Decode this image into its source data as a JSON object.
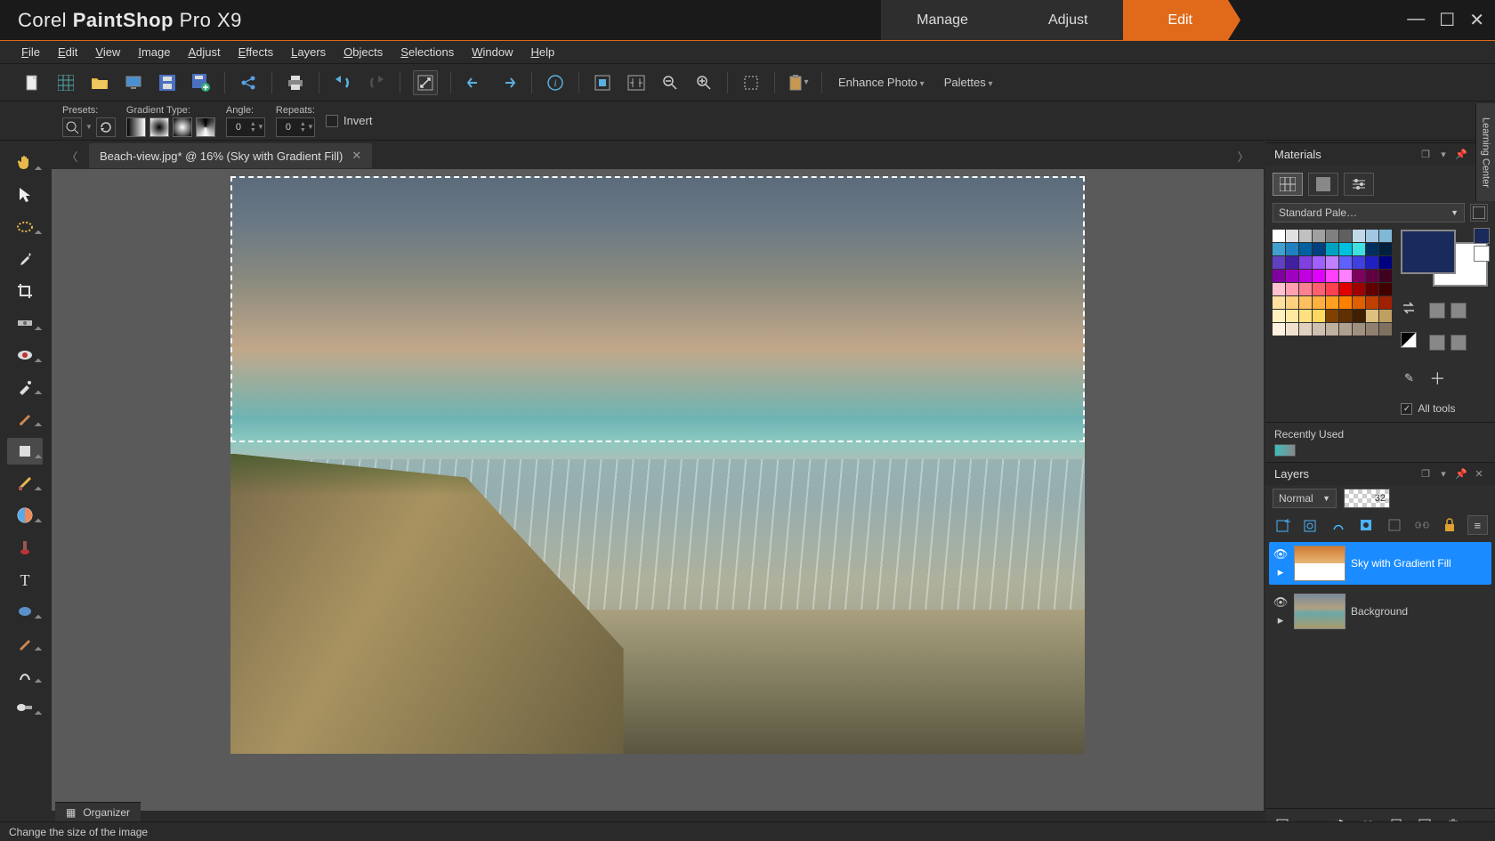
{
  "app": {
    "brand": "Corel",
    "product": "PaintShop",
    "suffix": "Pro X9"
  },
  "workspace_tabs": [
    "Manage",
    "Adjust",
    "Edit"
  ],
  "workspace_active": 2,
  "menu": [
    "File",
    "Edit",
    "View",
    "Image",
    "Adjust",
    "Effects",
    "Layers",
    "Objects",
    "Selections",
    "Window",
    "Help"
  ],
  "toolbar": {
    "enhance_label": "Enhance Photo",
    "palettes_label": "Palettes"
  },
  "options": {
    "presets_label": "Presets:",
    "gradient_type_label": "Gradient Type:",
    "angle_label": "Angle:",
    "angle_value": "0",
    "repeats_label": "Repeats:",
    "repeats_value": "0",
    "invert_label": "Invert"
  },
  "document": {
    "tab_title": "Beach-view.jpg* @  16% (Sky with Gradient Fill)"
  },
  "materials": {
    "title": "Materials",
    "palette_selector": "Standard Pale…",
    "recently_used_label": "Recently Used",
    "all_tools_label": "All tools",
    "fg_color": "#1a2a5a",
    "bg_color": "#ffffff",
    "grid_colors": [
      "#ffffff",
      "#e0e0e0",
      "#c0c0c0",
      "#a0a0a0",
      "#808080",
      "#606060",
      "#c0d8e8",
      "#a0c8e0",
      "#80b8d8",
      "#40a0d0",
      "#2080c0",
      "#0060a0",
      "#004080",
      "#00a0c0",
      "#00c0e0",
      "#40e0e0",
      "#003060",
      "#002040",
      "#6040c0",
      "#4020a0",
      "#8040e0",
      "#a060ff",
      "#c080ff",
      "#6060ff",
      "#4040e0",
      "#2020c0",
      "#000080",
      "#8000a0",
      "#a000c0",
      "#c000e0",
      "#e000ff",
      "#ff40ff",
      "#ff80ff",
      "#800060",
      "#600040",
      "#400020",
      "#ffc0d0",
      "#ffa0b0",
      "#ff8090",
      "#ff6070",
      "#ff4050",
      "#e00000",
      "#a00000",
      "#600000",
      "#400000",
      "#ffe0a0",
      "#ffd080",
      "#ffc060",
      "#ffb040",
      "#ffa020",
      "#ff8000",
      "#e06000",
      "#c04000",
      "#a02000",
      "#fff0c0",
      "#ffe8a0",
      "#ffe080",
      "#ffd860",
      "#804000",
      "#603000",
      "#402000",
      "#e0c080",
      "#c0a060",
      "#fff0e0",
      "#f0e0d0",
      "#e0d0c0",
      "#d0c0b0",
      "#c0b0a0",
      "#b0a090",
      "#a09080",
      "#908070",
      "#807060"
    ]
  },
  "layers": {
    "title": "Layers",
    "blend_mode": "Normal",
    "opacity": "32",
    "items": [
      {
        "name": "Sky with Gradient Fill",
        "selected": true,
        "thumb": "grad"
      },
      {
        "name": "Background",
        "selected": false,
        "thumb": "beach"
      }
    ]
  },
  "status": {
    "text": "Change the size of the image"
  },
  "organizer": {
    "label": "Organizer"
  },
  "learning_center": {
    "label": "Learning Center"
  }
}
